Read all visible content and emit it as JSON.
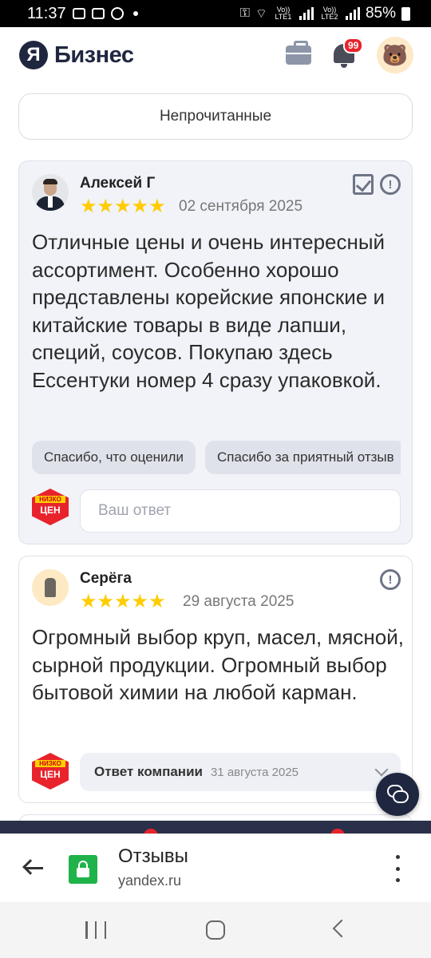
{
  "status_bar": {
    "time": "11:37",
    "battery": "85%",
    "sim1": "Vo)) LTE1",
    "sim2": "Vo)) LTE2"
  },
  "header": {
    "logo_letter": "Я",
    "logo_text": "Бизнес",
    "notification_count": "99"
  },
  "filter": {
    "label": "Непрочитанные"
  },
  "reviews": [
    {
      "author": "Алексей Г",
      "rating": 5,
      "stars": "★★★★★",
      "date": "02 сентября 2025",
      "text": "Отличные цены и очень интересный ассортимент. Особенно хорошо представлены корейские японские и китайские товары в виде лапши, специй, соусов. Покупаю здесь Ессентуки номер 4 сразу упаковкой.",
      "quick_replies": [
        "Спасибо, что оценили",
        "Спасибо за приятный отзыв"
      ],
      "reply_placeholder": "Ваш ответ"
    },
    {
      "author": "Серёга",
      "rating": 5,
      "stars": "★★★★★",
      "date": "29 августа 2025",
      "text": "Огромный выбор круп, масел, мясной, сырной продукции. Огромный выбор бытовой химии на любой карман.",
      "company_answer_label": "Ответ компании",
      "company_answer_date": "31 августа 2025"
    }
  ],
  "company": {
    "logo_line1": "НИЗКО",
    "logo_line2": "ЦЕН"
  },
  "browser": {
    "page_title": "Отзывы",
    "url": "yandex.ru"
  },
  "colors": {
    "brand_dark": "#1f2640",
    "star": "#ffcc00",
    "badge_red": "#e8232c",
    "lock_green": "#1fb34a",
    "card_bg": "#f1f3f8"
  },
  "icons": [
    "wifi-icon",
    "signal-icon",
    "battery-icon",
    "briefcase-icon",
    "bell-icon",
    "bear-avatar-icon",
    "check-square-icon",
    "info-icon",
    "chevron-down-icon",
    "chat-icon",
    "back-arrow-icon",
    "lock-icon",
    "menu-dots-icon",
    "recent-apps-icon",
    "home-icon",
    "nav-back-icon"
  ]
}
